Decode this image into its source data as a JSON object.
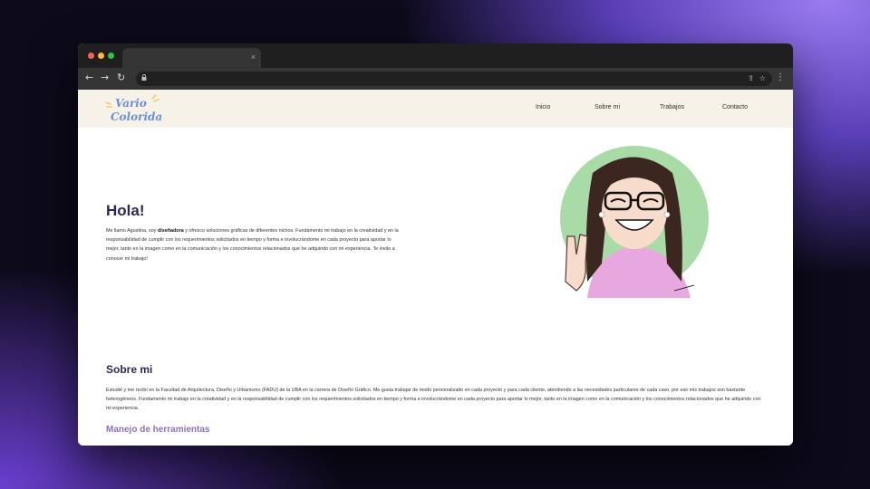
{
  "browser": {
    "tab_close": "×",
    "icons": [
      "back-icon",
      "forward-icon",
      "reload-icon",
      "lock-icon",
      "share-icon",
      "bookmark-star-icon",
      "menu-icon"
    ]
  },
  "site": {
    "logo_text": [
      "Vario",
      "Colorida"
    ],
    "nav": [
      "Inicio",
      "Sobre mi",
      "Trabajos",
      "Contacto"
    ],
    "hero": {
      "title": "Hola!",
      "text_before": "Me llamo Agustina, soy ",
      "text_bold": "diseñadora",
      "text_after": " y ofrezco soluciones gráficas de diferentes nichos. Fundamento mi trabajo en la creatividad y en la responsabilidad de cumplir con los requerimientos solicitados en tiempo y forma e involucrándome en cada proyecto para aportar lo mejor, tanto en la imagen como en la comunicación y los conocimientos relacionados que he adquirido con mi experiencia. Te invito a conocer mi trabajo!"
    },
    "about": {
      "title": "Sobre mi",
      "text": "Estudié y me recibí en la Facultad de Arquitectura, Diseño y Urbanismo (FADU) de la UBA en la carrera de Diseño Gráfico. Me gusta trabajar de modo personalizado en cada proyecto y para cada cliente, atendiendo a las necesidades particulares de cada caso, por eso mis trabajos son bastante heterogéneos. Fundamento mi trabajo en la creatividad y en la responsabilidad de cumplir con los requerimientos solicitados en tiempo y forma e involucrándome en cada proyecto para aportar lo mejor, tanto en la imagen como en la comunicación y los conocimientos relacionados que he adquirido con mi experiencia.",
      "subtitle": "Manejo de herramientas"
    }
  },
  "colors": {
    "header_bg": "#f6f2e8",
    "heading": "#2e2850",
    "subheading": "#8c72b8",
    "logo_blue": "#6b8fd6",
    "portrait_bg": "#a8dba6",
    "shirt": "#e7a8df"
  }
}
